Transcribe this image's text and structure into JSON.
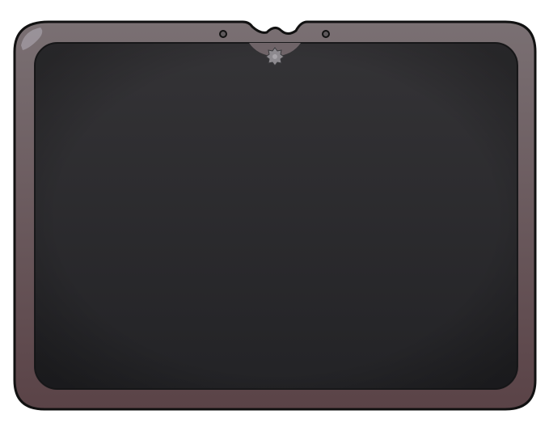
{
  "panel": {
    "frame_color_top": "#7a7073",
    "frame_color_bottom": "#5a4347",
    "outline_color": "#111111",
    "screen_color_top": "#343336",
    "screen_color_bottom": "#232326",
    "accent_color": "#8d8a8f",
    "icons": {
      "left_hole": "circle-hole-icon",
      "right_hole": "circle-hole-icon",
      "center_emblem": "gear-icon",
      "corner_highlight": "glare-icon"
    }
  }
}
